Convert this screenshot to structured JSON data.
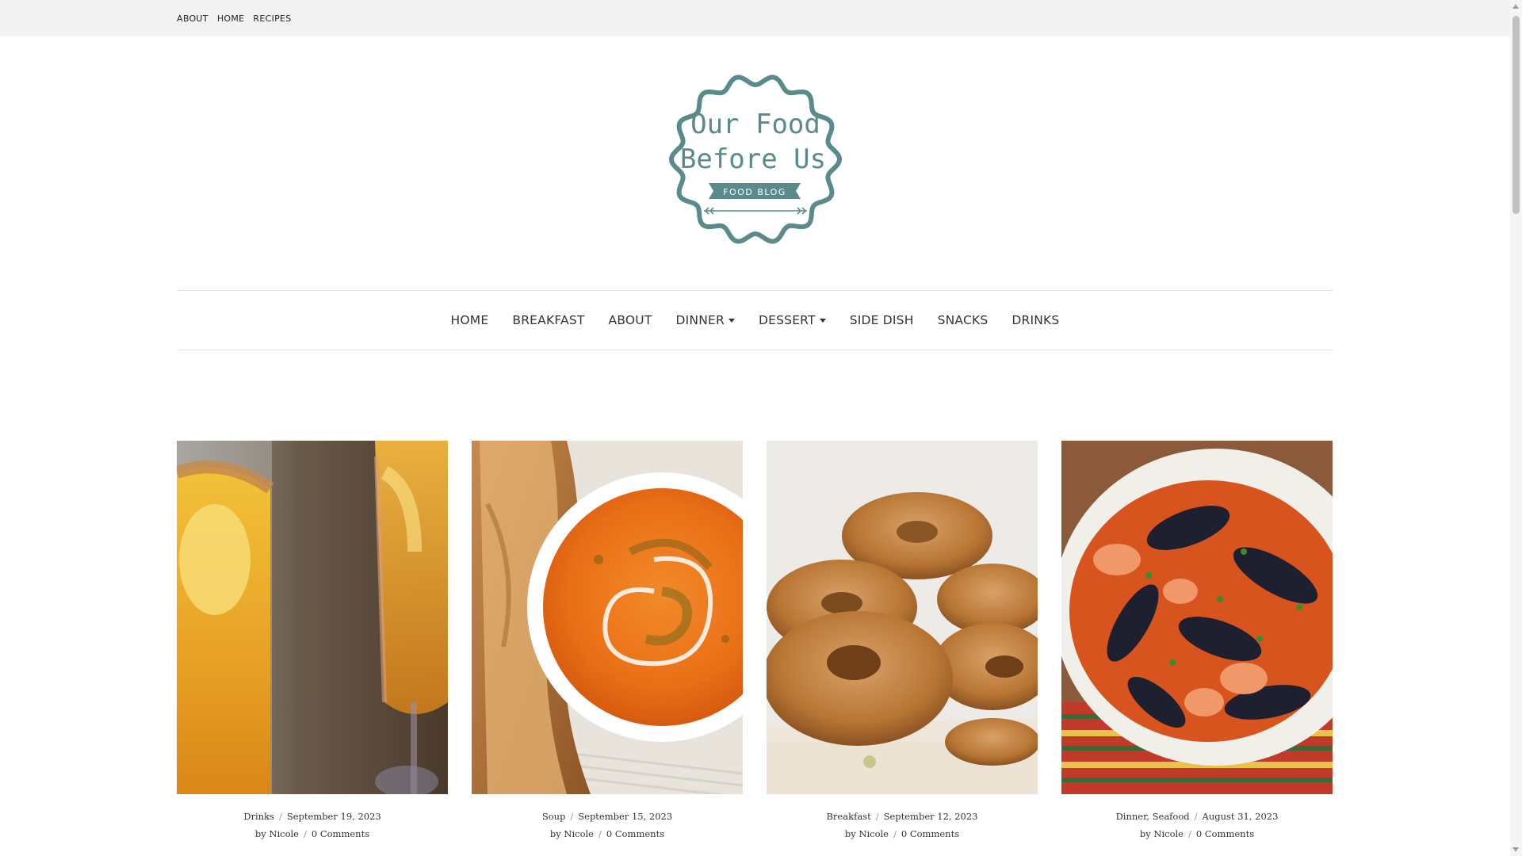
{
  "topbar": {
    "links": [
      "ABOUT",
      "HOME",
      "RECIPES"
    ]
  },
  "logo": {
    "line1": "Our Food",
    "line2": "Before Us",
    "ribbon": "FOOD BLOG"
  },
  "nav": {
    "items": [
      {
        "label": "HOME",
        "dropdown": false
      },
      {
        "label": "BREAKFAST",
        "dropdown": false
      },
      {
        "label": "ABOUT",
        "dropdown": false
      },
      {
        "label": "DINNER",
        "dropdown": true
      },
      {
        "label": "DESSERT",
        "dropdown": true
      },
      {
        "label": "SIDE DISH",
        "dropdown": false
      },
      {
        "label": "SNACKS",
        "dropdown": false
      },
      {
        "label": "DRINKS",
        "dropdown": false
      }
    ]
  },
  "posts": [
    {
      "category": "Drinks",
      "date": "September 19, 2023",
      "author_prefix": "by",
      "author": "Nicole",
      "comments": "0 Comments",
      "image": "cider-mimosa-glasses"
    },
    {
      "category": "Soup",
      "date": "September 15, 2023",
      "author_prefix": "by",
      "author": "Nicole",
      "comments": "0 Comments",
      "image": "tomato-soup-grilled-cheese"
    },
    {
      "category": "Breakfast",
      "date": "September 12, 2023",
      "author_prefix": "by",
      "author": "Nicole",
      "comments": "0 Comments",
      "image": "cinnamon-sugar-donuts"
    },
    {
      "category": "Dinner, Seafood",
      "date": "August 31, 2023",
      "author_prefix": "by",
      "author": "Nicole",
      "comments": "0 Comments",
      "image": "seafood-stew-mussels"
    }
  ],
  "colors": {
    "logo_teal": "#5a8a8b",
    "topbar_bg": "#f2f2f2",
    "text": "#333333"
  }
}
